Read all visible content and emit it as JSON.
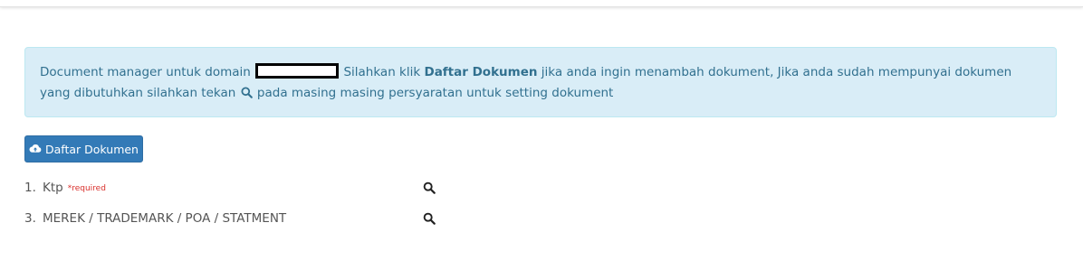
{
  "alert": {
    "text_before_domain": "Document manager untuk domain",
    "text_after_domain": "Silahkan klik",
    "bold_link_text": "Daftar Dokumen",
    "text_after_bold": "jika anda ingin menambah dokument, Jika anda sudah mempunyai dokumen yang dibutuhkan silahkan tekan",
    "text_end": "pada masing masing persyaratan untuk setting dokument",
    "inline_icon": "search-icon"
  },
  "button": {
    "label": "Daftar Dokumen",
    "icon": "cloud-upload-icon"
  },
  "requirements": [
    {
      "number": "1.",
      "label": "Ktp",
      "required_tag": "*required",
      "icon": "search-icon"
    },
    {
      "number": "3.",
      "label": "MEREK / TRADEMARK / POA / STATMENT",
      "required_tag": "",
      "icon": "search-icon"
    }
  ],
  "colors": {
    "alert_bg": "#d9edf7",
    "alert_text": "#31708f",
    "button_bg": "#337ab7",
    "required": "#d9302c"
  }
}
